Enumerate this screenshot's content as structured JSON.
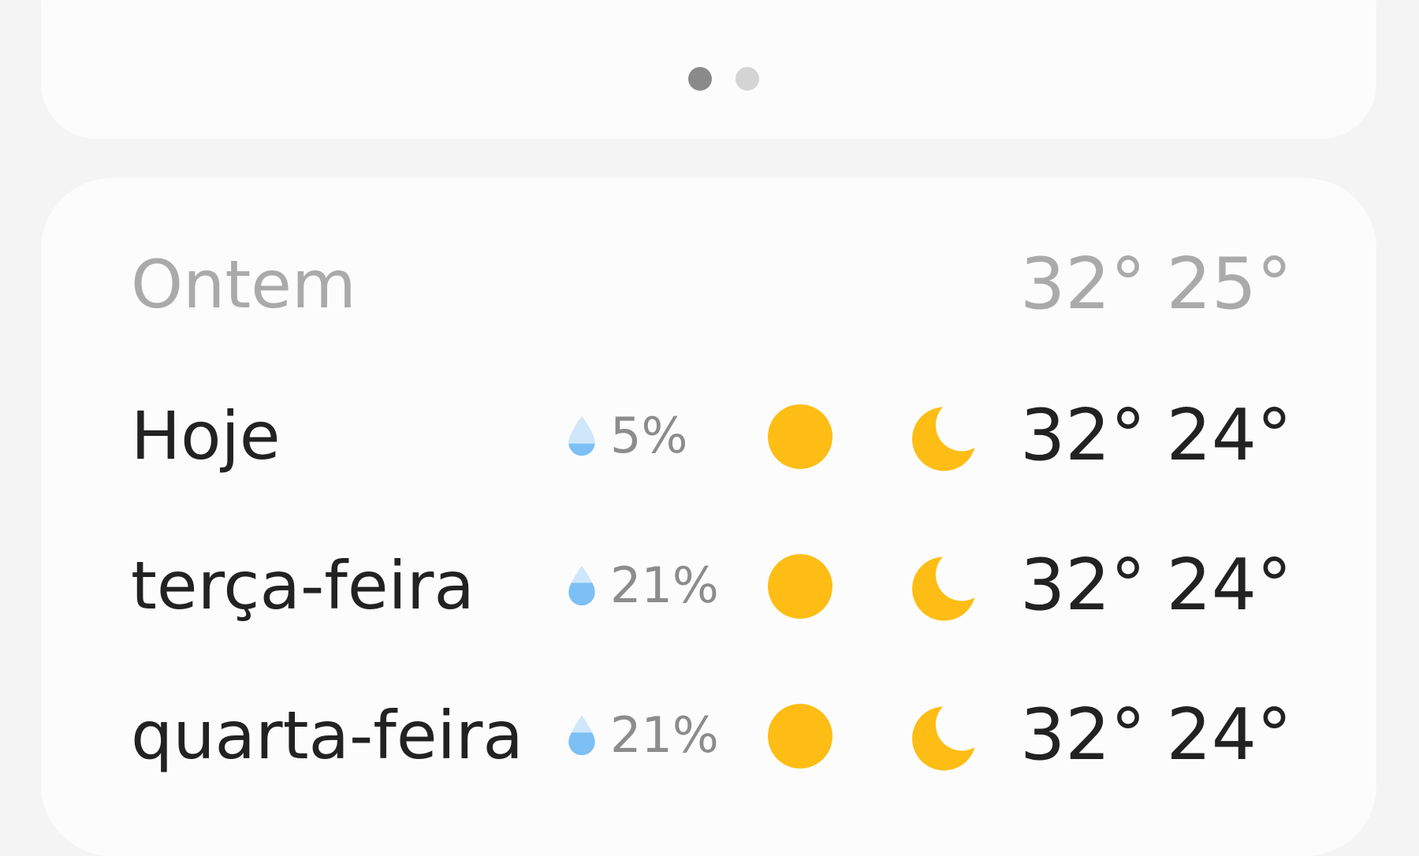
{
  "pager": {
    "pages": 2,
    "active_index": 0
  },
  "colors": {
    "sun": "#fdbd14",
    "moon": "#fdbd14",
    "drop_light": "#cfe6fb",
    "drop_fill": "#7cc0f5",
    "muted_text": "#aaaaaa",
    "primary_text": "#222222"
  },
  "forecast": {
    "yesterday": {
      "day": "Ontem",
      "high": "32°",
      "low": "25°"
    },
    "rows": [
      {
        "day": "Hoje",
        "precip": "5%",
        "precip_fraction": 0.05,
        "day_icon": "sun-icon",
        "night_icon": "moon-icon",
        "high": "32°",
        "low": "24°"
      },
      {
        "day": "terça-feira",
        "precip": "21%",
        "precip_fraction": 0.21,
        "day_icon": "sun-icon",
        "night_icon": "moon-icon",
        "high": "32°",
        "low": "24°"
      },
      {
        "day": "quarta-feira",
        "precip": "21%",
        "precip_fraction": 0.21,
        "day_icon": "sun-icon",
        "night_icon": "moon-icon",
        "high": "32°",
        "low": "24°"
      }
    ]
  }
}
